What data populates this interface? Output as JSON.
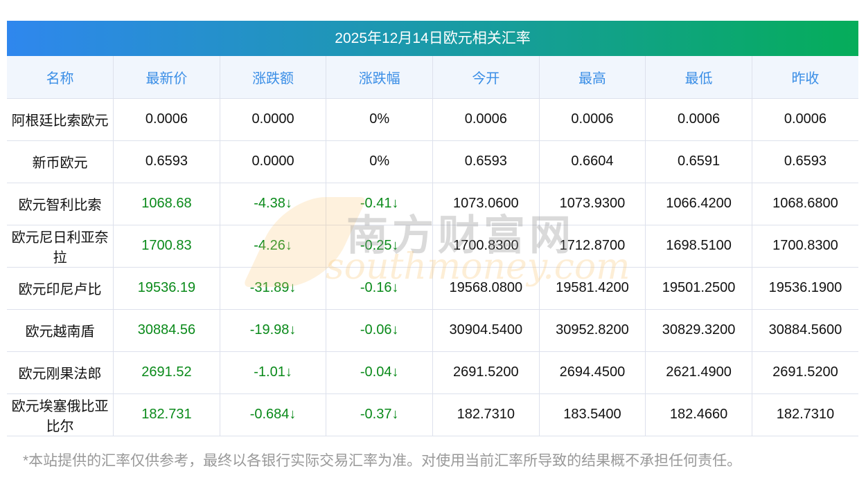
{
  "title": "2025年12月14日欧元相关汇率",
  "headers": [
    "名称",
    "最新价",
    "涨跌额",
    "涨跌幅",
    "今开",
    "最高",
    "最低",
    "昨收"
  ],
  "rows": [
    [
      "阿根廷比索欧元",
      "0.0006",
      "0.0000",
      "0%",
      "0.0006",
      "0.0006",
      "0.0006",
      "0.0006"
    ],
    [
      "新币欧元",
      "0.6593",
      "0.0000",
      "0%",
      "0.6593",
      "0.6604",
      "0.6591",
      "0.6593"
    ],
    [
      "欧元智利比索",
      "1068.68",
      "-4.38↓",
      "-0.41↓",
      "1073.0600",
      "1073.9300",
      "1066.4200",
      "1068.6800"
    ],
    [
      "欧元尼日利亚奈拉",
      "1700.83",
      "-4.26↓",
      "-0.25↓",
      "1700.8300",
      "1712.8700",
      "1698.5100",
      "1700.8300"
    ],
    [
      "欧元印尼卢比",
      "19536.19",
      "-31.89↓",
      "-0.16↓",
      "19568.0800",
      "19581.4200",
      "19501.2500",
      "19536.1900"
    ],
    [
      "欧元越南盾",
      "30884.56",
      "-19.98↓",
      "-0.06↓",
      "30904.5400",
      "30952.8200",
      "30829.3200",
      "30884.5600"
    ],
    [
      "欧元刚果法郎",
      "2691.52",
      "-1.01↓",
      "-0.04↓",
      "2691.5200",
      "2694.4500",
      "2621.4900",
      "2691.5200"
    ],
    [
      "欧元埃塞俄比亚比尔",
      "182.731",
      "-0.684↓",
      "-0.37↓",
      "182.7310",
      "183.5400",
      "182.4660",
      "182.7310"
    ]
  ],
  "green_rows": [
    2,
    3,
    4,
    5,
    6,
    7
  ],
  "watermark": {
    "cn": "南方财富网",
    "en": "southmoney.com"
  },
  "footnote": "*本站提供的汇率仅供参考，最终以各银行实际交易汇率为准。对使用当前汇率所导致的结果概不承担任何责任。",
  "colors": {
    "header_text": "#3a8ee6",
    "down": "#0a8a1a"
  }
}
